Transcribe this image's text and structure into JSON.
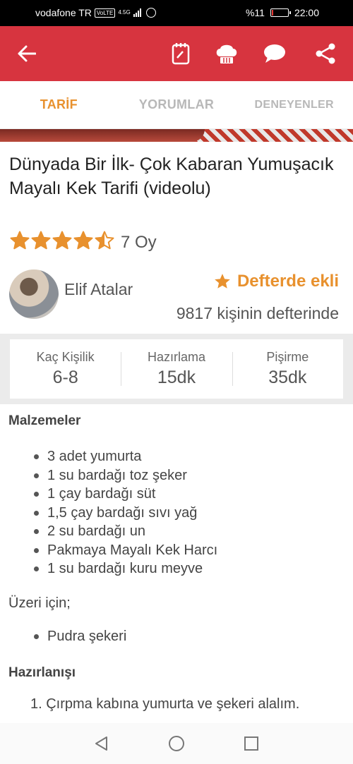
{
  "status": {
    "carrier": "vodafone TR",
    "volte": "VoLTE",
    "network": "4.5G",
    "battery": "%11",
    "battery_level": 0.11,
    "time": "22:00"
  },
  "appbar": {
    "icons": [
      "back-arrow-icon",
      "notebook-icon",
      "chef-hat-icon",
      "comment-icon",
      "share-icon"
    ],
    "color": "#d7343f"
  },
  "tabs": [
    {
      "label": "TARİF",
      "active": true
    },
    {
      "label": "YORUMLAR",
      "active": false
    },
    {
      "label": "DENEYENLER",
      "active": false
    }
  ],
  "recipe": {
    "title": "Dünyada Bir İlk- Çok Kabaran Yumuşacık Mayalı Kek Tarifi (videolu)",
    "rating": 4.5,
    "votes": "7 Oy",
    "author": "Elif Atalar",
    "favorite_label": "Defterde ekli",
    "favorite_count": "9817 kişinin defterinde"
  },
  "info": [
    {
      "label": "Kaç Kişilik",
      "value": "6-8"
    },
    {
      "label": "Hazırlama",
      "value": "15dk"
    },
    {
      "label": "Pişirme",
      "value": "35dk"
    }
  ],
  "ingredients": {
    "heading": "Malzemeler",
    "items": [
      "3 adet yumurta",
      "1 su bardağı toz şeker",
      "1 çay bardağı süt",
      "1,5 çay bardağı sıvı yağ",
      "2 su bardağı un",
      "Pakmaya Mayalı Kek Harcı",
      "1 su bardağı kuru meyve"
    ],
    "topping_heading": "Üzeri için;",
    "topping_items": [
      "Pudra şekeri"
    ]
  },
  "preparation": {
    "heading": "Hazırlanışı",
    "steps": [
      "1. Çırpma kabına yumurta ve şekeri alalım."
    ]
  },
  "colors": {
    "accent": "#e8912e",
    "brand": "#d7343f"
  }
}
